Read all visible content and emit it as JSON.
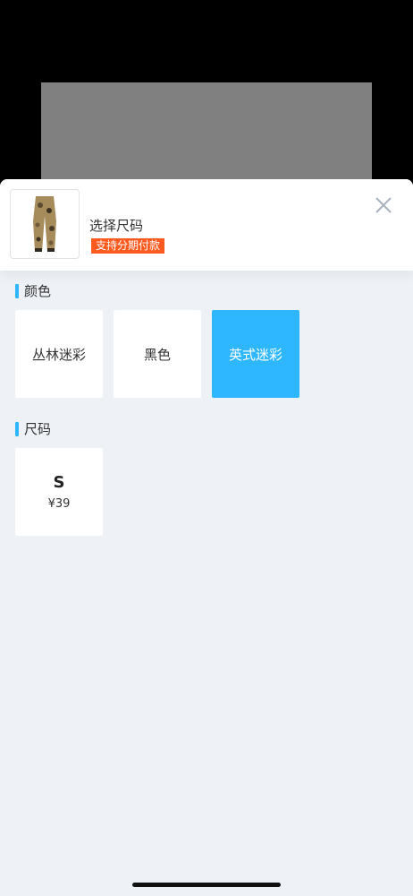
{
  "product": {
    "title": "选择尺码",
    "badge": "支持分期付款",
    "thumbnail_icon": "camo-pants-image"
  },
  "color_section": {
    "label": "颜色",
    "options": [
      {
        "label": "丛林迷彩",
        "selected": false
      },
      {
        "label": "黑色",
        "selected": false
      },
      {
        "label": "英式迷彩",
        "selected": true
      }
    ]
  },
  "size_section": {
    "label": "尺码",
    "options": [
      {
        "size": "S",
        "price": "¥39"
      }
    ]
  },
  "colors": {
    "accent": "#2eb7ff",
    "badge": "#ff5a1f",
    "sheet_background": "#eef2f6",
    "backdrop_image_placeholder": "#808080"
  }
}
